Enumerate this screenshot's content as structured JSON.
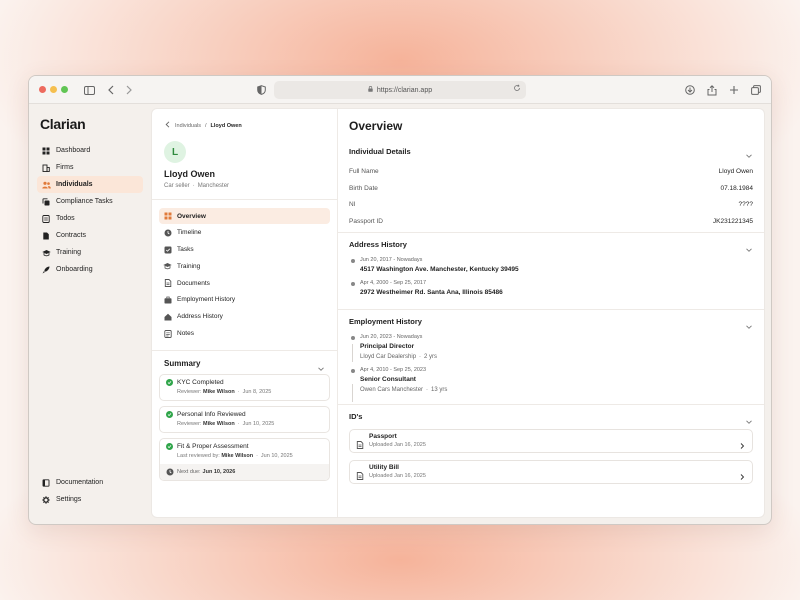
{
  "browser": {
    "url": "https://clarian.app"
  },
  "app": {
    "logo": "Clarian"
  },
  "sidebar": {
    "items": [
      {
        "label": "Dashboard",
        "icon": "grid-icon"
      },
      {
        "label": "Firms",
        "icon": "building-icon"
      },
      {
        "label": "Individuals",
        "icon": "users-icon"
      },
      {
        "label": "Compliance Tasks",
        "icon": "copy-icon"
      },
      {
        "label": "Todos",
        "icon": "list-icon"
      },
      {
        "label": "Contracts",
        "icon": "file-icon"
      },
      {
        "label": "Training",
        "icon": "graduation-cap-icon"
      },
      {
        "label": "Onboarding",
        "icon": "rocket-icon"
      }
    ],
    "active_index": 2,
    "bottom": [
      {
        "label": "Documentation",
        "icon": "book-icon"
      },
      {
        "label": "Settings",
        "icon": "gear-icon"
      }
    ]
  },
  "breadcrumb": {
    "parent": "Individuals",
    "sep": "/",
    "current": "Lloyd Owen"
  },
  "profile": {
    "initial": "L",
    "name": "Lloyd Owen",
    "role": "Car seller",
    "sep": "·",
    "location": "Manchester"
  },
  "menu": [
    {
      "label": "Overview"
    },
    {
      "label": "Timeline"
    },
    {
      "label": "Tasks"
    },
    {
      "label": "Training"
    },
    {
      "label": "Documents"
    },
    {
      "label": "Employment History"
    },
    {
      "label": "Address History"
    },
    {
      "label": "Notes"
    }
  ],
  "summary": {
    "title": "Summary",
    "cards": [
      {
        "title": "KYC Completed",
        "reviewer_label": "Reviewer:",
        "reviewer": "Mike Wilson",
        "sep": "·",
        "date": "Jun 8, 2025"
      },
      {
        "title": "Personal Info Reviewed",
        "reviewer_label": "Reviewer:",
        "reviewer": "Mike Wilson",
        "sep": "·",
        "date": "Jun 10, 2025"
      },
      {
        "title": "Fit & Proper Assessment",
        "reviewer_label": "Last reviewed by:",
        "reviewer": "Mike Wilson",
        "sep": "·",
        "date": "Jun 10, 2025",
        "next_label": "Next due:",
        "next_date": "Jun 10, 2026"
      }
    ]
  },
  "overview": {
    "title": "Overview",
    "individual": {
      "title": "Individual Details",
      "rows": [
        {
          "key": "Full Name",
          "value": "Lloyd Owen"
        },
        {
          "key": "Birth Date",
          "value": "07.18.1984"
        },
        {
          "key": "NI",
          "value": "????"
        },
        {
          "key": "Passport ID",
          "value": "JK231221345"
        }
      ]
    },
    "address": {
      "title": "Address History",
      "items": [
        {
          "date": "Jun 20, 2017 - Nowadays",
          "address": "4517 Washington Ave. Manchester, Kentucky 39495"
        },
        {
          "date": "Apr 4, 2000 - Sep 25, 2017",
          "address": "2972 Westheimer Rd. Santa Ana, Illinois 85486"
        }
      ]
    },
    "employment": {
      "title": "Employment History",
      "items": [
        {
          "date": "Jun 20, 2023 - Nowadays",
          "role": "Principal Director",
          "company": "Lloyd Car Dealership",
          "sep": "·",
          "duration": "2 yrs"
        },
        {
          "date": "Apr 4, 2010 - Sep 25, 2023",
          "role": "Senior Consultant",
          "company": "Owen Cars Manchester",
          "sep": "·",
          "duration": "13 yrs"
        }
      ]
    },
    "ids": {
      "title": "ID's",
      "items": [
        {
          "name": "Passport",
          "uploaded": "Uploaded Jan 16, 2025"
        },
        {
          "name": "Utility Bill",
          "uploaded": "Uploaded Jan 16, 2025"
        }
      ]
    }
  },
  "colors": {
    "accent": "#e07a3a",
    "success": "#2fa54a",
    "active_bg": "#fbe6d8"
  }
}
